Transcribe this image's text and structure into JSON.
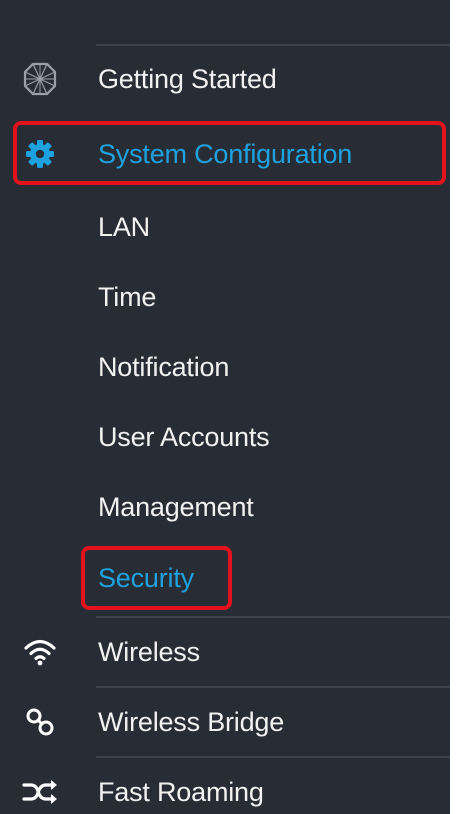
{
  "sidebar": {
    "items": [
      {
        "label": "Getting Started",
        "icon": "getting-started-icon"
      },
      {
        "label": "System Configuration",
        "icon": "gear-icon",
        "active": true
      },
      {
        "label": "LAN"
      },
      {
        "label": "Time"
      },
      {
        "label": "Notification"
      },
      {
        "label": "User Accounts"
      },
      {
        "label": "Management"
      },
      {
        "label": "Security",
        "active": true
      },
      {
        "label": "Wireless",
        "icon": "wifi-icon"
      },
      {
        "label": "Wireless Bridge",
        "icon": "bridge-icon"
      },
      {
        "label": "Fast Roaming",
        "icon": "fast-roaming-icon"
      }
    ]
  },
  "colors": {
    "sidebar_bg": "#282c34",
    "text": "#f2f2f2",
    "active": "#1ea2df",
    "highlight": "#e4121d"
  }
}
